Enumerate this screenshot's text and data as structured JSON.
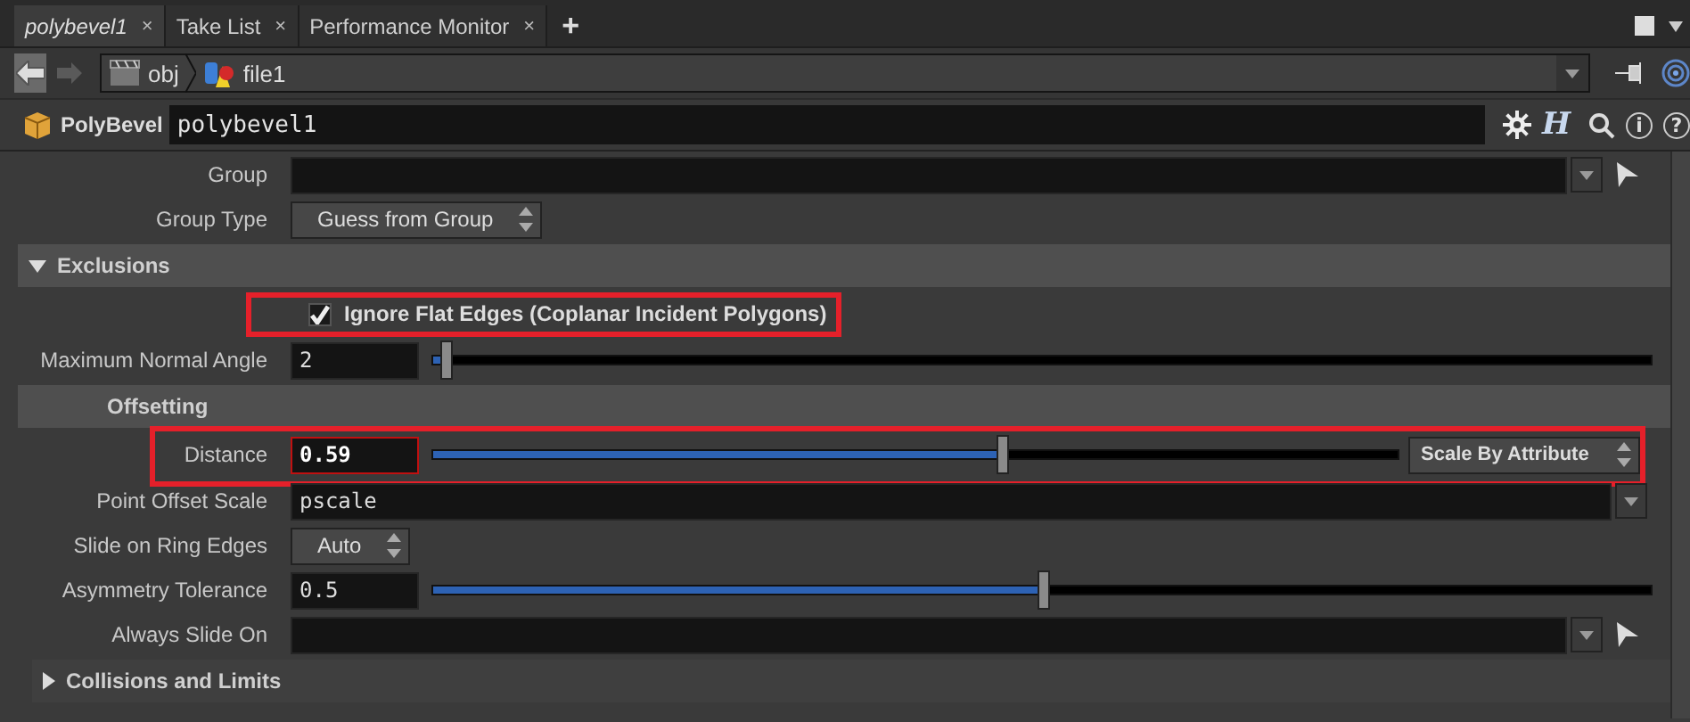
{
  "tabs": [
    {
      "label": "polybevel1",
      "selected": true,
      "close": "×"
    },
    {
      "label": "Take List",
      "selected": false,
      "close": "×"
    },
    {
      "label": "Performance Monitor",
      "selected": false,
      "close": "×"
    }
  ],
  "new_tab": "+",
  "path": {
    "segments": [
      {
        "label": "obj",
        "kind": "network"
      },
      {
        "label": "file1",
        "kind": "geometry"
      }
    ]
  },
  "node": {
    "type": "PolyBevel",
    "name": "polybevel1"
  },
  "node_tools": [
    {
      "kind": "gear"
    },
    {
      "kind": "glyph",
      "label": "H"
    },
    {
      "kind": "search"
    },
    {
      "kind": "circle",
      "label": "i"
    },
    {
      "kind": "circle",
      "label": "?"
    }
  ],
  "parameters": [
    {
      "kind": "field",
      "label": "Group",
      "dropdown": true,
      "select_arrow": true
    },
    {
      "kind": "menu",
      "label": "Group Type",
      "value": "Guess from Group"
    },
    {
      "kind": "section",
      "label": "Exclusions",
      "expanded": true
    },
    {
      "kind": "checkbox",
      "label": "Ignore Flat Edges (Coplanar Incident Polygons)",
      "checked": true,
      "highlighted": true
    },
    {
      "kind": "slider",
      "label": "Maximum Normal Angle",
      "value": "2",
      "level": 0.01
    },
    {
      "kind": "heading",
      "label": "Offsetting"
    },
    {
      "kind": "slider",
      "label": "Distance",
      "value": "0.59",
      "level": 0.59,
      "focused": true,
      "highlighted": true,
      "menu": "Scale By Attribute"
    },
    {
      "kind": "field",
      "label": "Point Offset Scale",
      "value": "pscale",
      "dropdown": true
    },
    {
      "kind": "menu",
      "label": "Slide on Ring Edges",
      "value": "Auto"
    },
    {
      "kind": "slider",
      "label": "Asymmetry Tolerance",
      "value": "0.5",
      "level": 0.5
    },
    {
      "kind": "field",
      "label": "Always Slide On",
      "dropdown": true,
      "select_arrow": true
    },
    {
      "kind": "section",
      "label": "Collisions and Limits",
      "expanded": false
    }
  ]
}
